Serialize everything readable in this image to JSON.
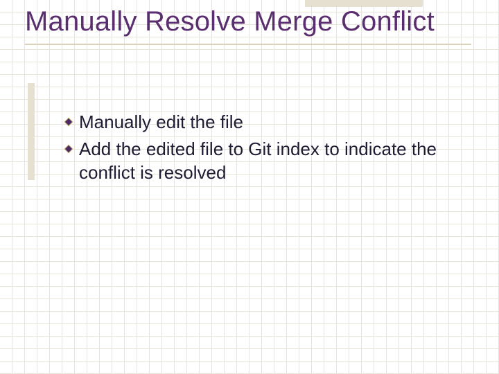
{
  "slide": {
    "title": "Manually Resolve Merge Conflict",
    "bullets": [
      "Manually edit the file",
      "Add the edited file to Git index to indicate the conflict is resolved"
    ]
  }
}
